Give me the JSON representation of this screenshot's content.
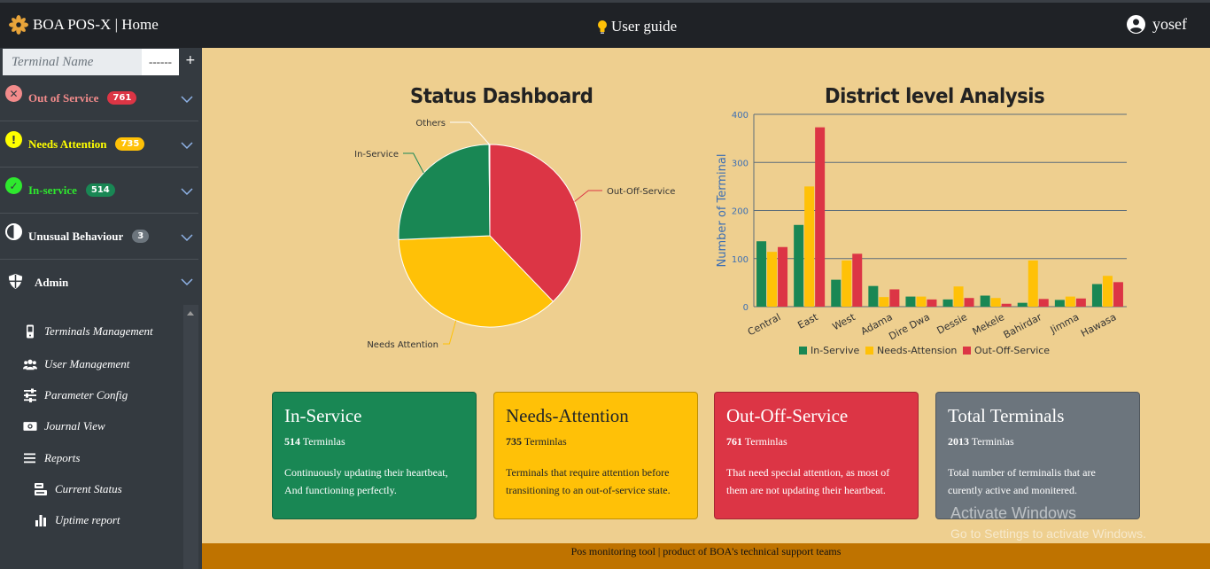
{
  "topbar": {
    "brand": "BOA POS-X | Home",
    "guide": "User guide",
    "username": "yosef"
  },
  "sidebar": {
    "search_placeholder": "Terminal Name",
    "select_value": "------",
    "add": "+",
    "statuses": [
      {
        "label": "Out of Service",
        "count": "761",
        "color": "#f28b8b",
        "badge": "#dc3545",
        "badge_text": "#fff",
        "icon": "x-circle-icon",
        "glyph": "✕"
      },
      {
        "label": "Needs Attention",
        "count": "735",
        "color": "#ffff00",
        "badge": "#ffc107",
        "badge_text": "#fff",
        "icon": "exclamation-circle-icon",
        "glyph": "!"
      },
      {
        "label": "In-service",
        "count": "514",
        "color": "#2ee82e",
        "badge": "#198754",
        "badge_text": "#fff",
        "icon": "check-circle-icon",
        "glyph": "✓"
      },
      {
        "label": "Unusual Behaviour",
        "count": "3",
        "color": "#ffffff",
        "badge": "#6c757d",
        "badge_text": "#fff",
        "icon": "half-circle-icon",
        "glyph": ""
      }
    ],
    "admin_label": "Admin",
    "menu": {
      "terminals": "Terminals Management",
      "users": "User Management",
      "params": "Parameter Config",
      "journal": "Journal View",
      "reports": "Reports",
      "current": "Current Status",
      "uptime": "Uptime report"
    }
  },
  "status_panel": {
    "title": "Status Dashboard"
  },
  "district_panel": {
    "title": "District level Analysis"
  },
  "chart_data": [
    {
      "type": "pie",
      "title": "Status Dashboard",
      "labels": [
        "Out-Off-Service",
        "Needs Attention",
        "In-Service",
        "Others"
      ],
      "values": [
        761,
        735,
        514,
        3
      ],
      "colors": [
        "#dc3545",
        "#ffc107",
        "#198754",
        "#f8f8f8"
      ]
    },
    {
      "type": "bar",
      "title": "District level Analysis",
      "ylabel": "Number of Terminal",
      "ylim": [
        0,
        400
      ],
      "yticks": [
        0,
        100,
        200,
        300,
        400
      ],
      "grid": true,
      "legend": "bottom",
      "categories": [
        "Central",
        "East",
        "West",
        "Adama",
        "Dire Dwa",
        "Dessie",
        "Mekele",
        "Bahirdar",
        "Jimma",
        "Hawasa"
      ],
      "series": [
        {
          "name": "In-Servive",
          "color": "#198754",
          "values": [
            136,
            170,
            56,
            43,
            21,
            15,
            23,
            8,
            14,
            47
          ]
        },
        {
          "name": "Needs-Attension",
          "color": "#ffc107",
          "values": [
            114,
            250,
            96,
            20,
            21,
            42,
            18,
            96,
            21,
            64
          ]
        },
        {
          "name": "Out-Off-Service",
          "color": "#dc3545",
          "values": [
            124,
            373,
            110,
            36,
            15,
            18,
            6,
            16,
            17,
            51
          ]
        }
      ]
    }
  ],
  "cards": [
    {
      "title": "In-Service",
      "count": "514",
      "unit": "Terminlas",
      "desc": "Continuously updating their heartbeat, And functioning perfectly.",
      "bg": "#198754",
      "fg": "#ffffff"
    },
    {
      "title": "Needs-Attention",
      "count": "735",
      "unit": "Terminlas",
      "desc": "Terminals that require attention before transitioning to an out-of-service state.",
      "bg": "#ffc107",
      "fg": "#212529"
    },
    {
      "title": "Out-Off-Service",
      "count": "761",
      "unit": "Terminlas",
      "desc": "That need special attention, as most of them are not updating their heartbeat.",
      "bg": "#dc3545",
      "fg": "#ffffff"
    },
    {
      "title": "Total Terminals",
      "count": "2013",
      "unit": "Terminlas",
      "desc": "Total number of terminalis that are curently active and monitered.",
      "bg": "#6c757d",
      "fg": "#ffffff"
    }
  ],
  "watermark": {
    "line1": "Activate Windows",
    "line2": "Go to Settings to activate Windows."
  },
  "footer": "Pos monitoring tool | product of BOA's technical support teams"
}
